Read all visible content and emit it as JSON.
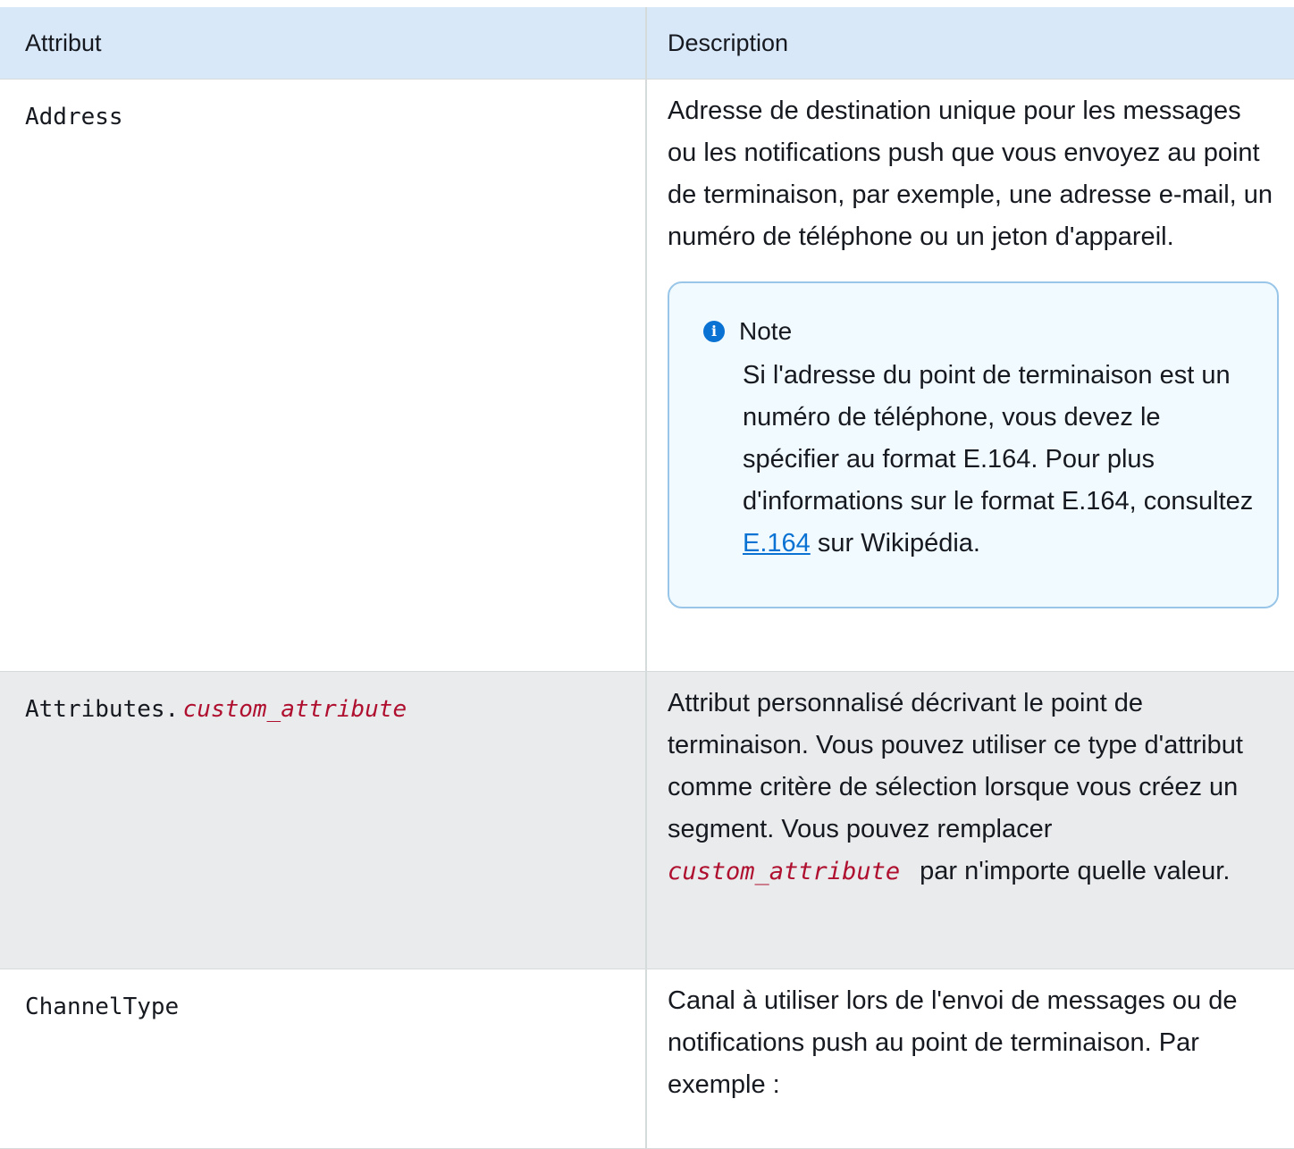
{
  "header": {
    "attribute_label": "Attribut",
    "description_label": "Description"
  },
  "rows": [
    {
      "attribute": "Address",
      "description": "Adresse de destination unique pour les messages ou les notifications push que vous envoyez au point de terminaison, par exemple, une adresse e-mail, un numéro de téléphone ou un jeton d'appareil.",
      "note": {
        "icon": "info-icon",
        "title": "Note",
        "text_before_link": "Si l'adresse du point de terminaison est un numéro de téléphone, vous devez le spécifier au format E.164. Pour plus d'informations sur le format E.164, consultez ",
        "link_text": "E.164",
        "text_after_link": " sur Wikipédia."
      }
    },
    {
      "attribute_prefix": "Attributes.",
      "attribute_variable": "custom_attribute",
      "description_before": "Attribut personnalisé décrivant le point de terminaison. Vous pouvez utiliser ce type d'attribut comme critère de sélection lorsque vous créez un segment. Vous pouvez remplacer ",
      "description_variable": "custom_attribute",
      "description_after": "par n'importe quelle valeur."
    },
    {
      "attribute": "ChannelType",
      "description": "Canal à utiliser lors de l'envoi de messages ou de notifications push au point de terminaison. Par exemple :"
    }
  ],
  "colors": {
    "header_bg": "#d8e8f8",
    "shaded_row_bg": "#e9ebed",
    "variable_text": "#b0102f",
    "link": "#0972d3",
    "note_border": "#99c6e8",
    "note_bg": "#f1faff"
  }
}
